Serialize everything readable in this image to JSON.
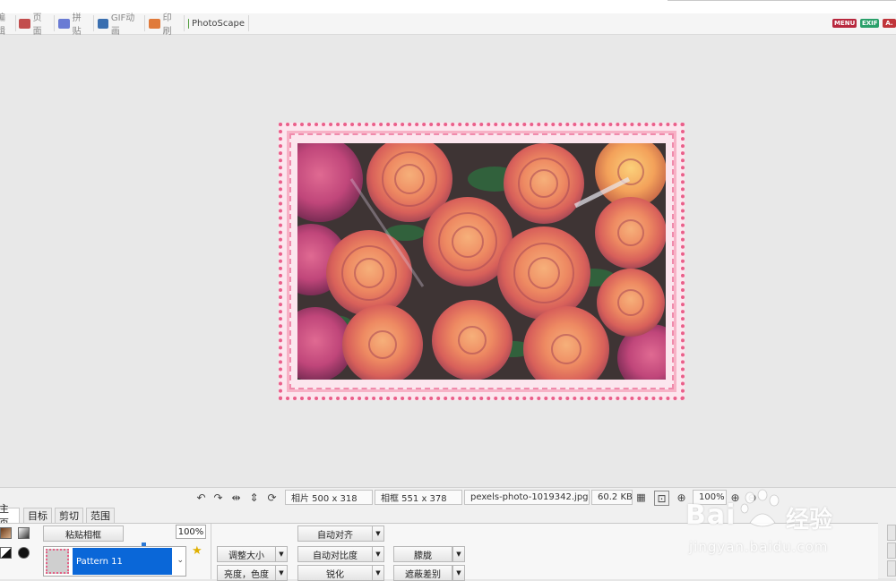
{
  "toolbar_tabs": [
    {
      "label": "编辑",
      "color": "#d46a6a"
    },
    {
      "label": "页面",
      "color": "#c24d4d"
    },
    {
      "label": "拼贴",
      "color": "#6a7bd4"
    },
    {
      "label": "GIF动画",
      "color": "#3a6fb0"
    },
    {
      "label": "印刷",
      "color": "#e07a3a"
    },
    {
      "label": "PhotoScape",
      "color": "#4e9a3a"
    }
  ],
  "badges": [
    {
      "label": "MENU",
      "color": "#b8283e"
    },
    {
      "label": "EXIF",
      "color": "#2aa06a"
    },
    {
      "label": "A.",
      "color": "#c0343a"
    }
  ],
  "status": {
    "photo_size": "相片 500 x 318",
    "frame_size": "相框 551 x 378",
    "filename": "pexels-photo-1019342.jpg",
    "filesize": "60.2 KB",
    "zoom": "100%"
  },
  "status_icons": [
    "undo-icon",
    "redo-icon",
    "flip-horizontal-icon",
    "flip-vertical-icon",
    "rotate-icon"
  ],
  "bottom_tabs": [
    "主页",
    "目标",
    "剪切",
    "范围"
  ],
  "frame_panel": {
    "paste_frame": "粘贴相框",
    "opacity": "100%",
    "pattern": "Pattern 11"
  },
  "actions": {
    "auto_align": "自动对齐",
    "resize": "调整大小",
    "auto_contrast": "自动对比度",
    "blur": "朦胧",
    "brightness_color": "亮度，色度",
    "sharpen": "锐化",
    "mask_diff": "遮蔽差别"
  },
  "watermark": {
    "brand_left": "Bai",
    "brand_right": "经验",
    "url": "jingyan.baidu.com"
  },
  "colors": {
    "selection": "#0a67d8",
    "frame_pink": "#ea5f8a",
    "watermark": "#ffffff"
  }
}
